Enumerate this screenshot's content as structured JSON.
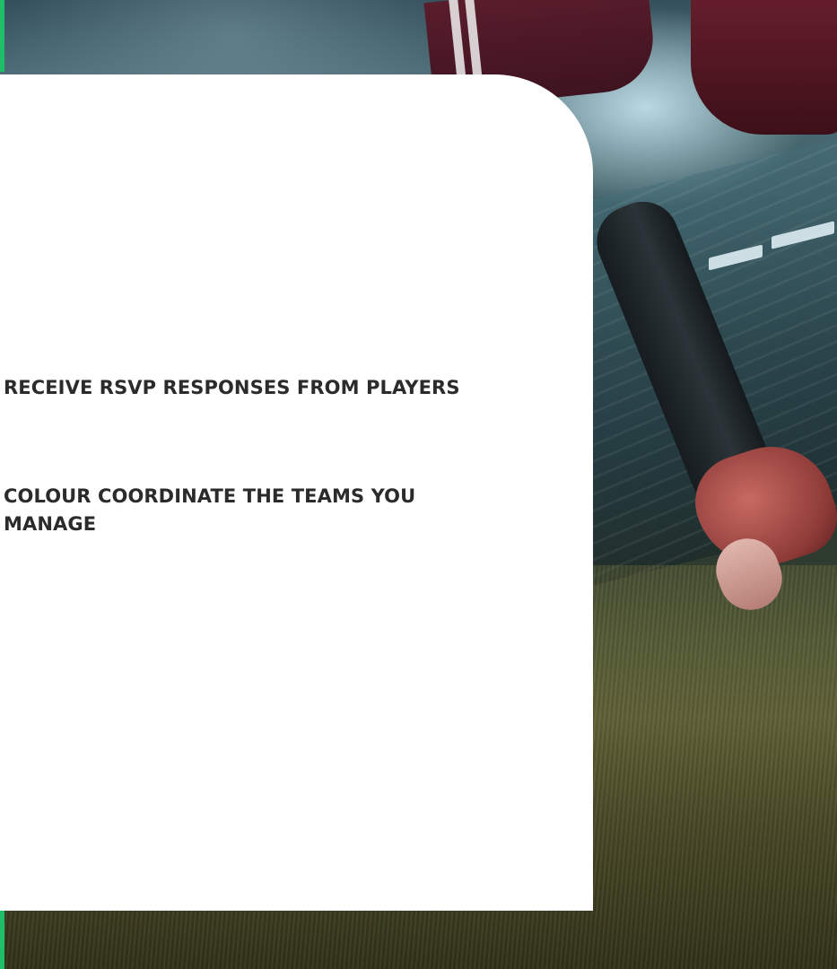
{
  "features": {
    "items": [
      {
        "label": "RECEIVE RSVP RESPONSES FROM PLAYERS"
      },
      {
        "label": "COLOUR COORDINATE THE TEAMS YOU MANAGE"
      }
    ]
  },
  "colors": {
    "accent": "#1fbf6a",
    "card_background": "#ffffff",
    "text": "#2b2b2b"
  }
}
